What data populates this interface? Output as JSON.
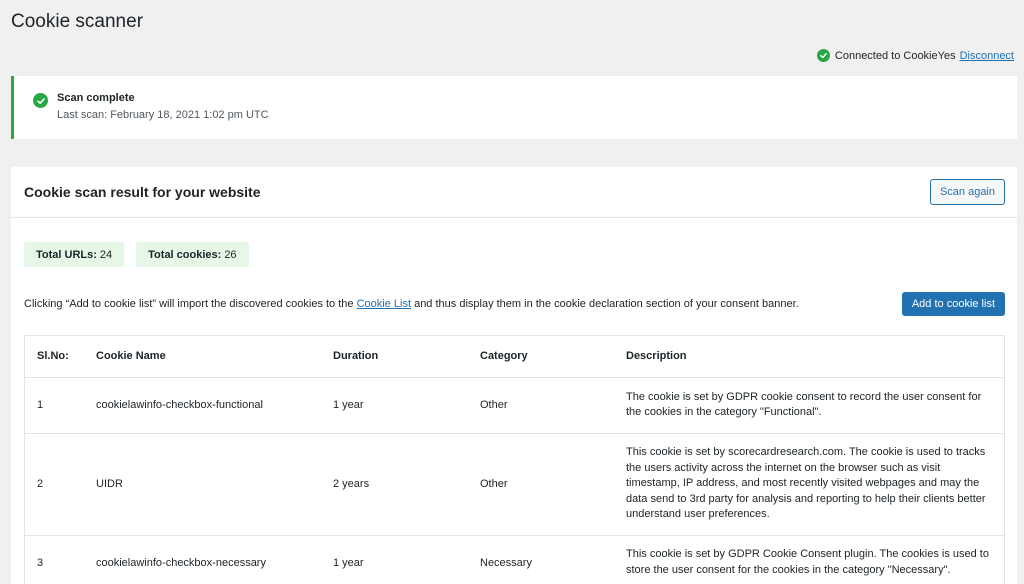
{
  "page_title": "Cookie scanner",
  "connection": {
    "status_text": "Connected to CookieYes",
    "disconnect_label": "Disconnect"
  },
  "notice": {
    "title": "Scan complete",
    "subtitle": "Last scan: February 18, 2021 1:02 pm UTC"
  },
  "panel": {
    "title": "Cookie scan result for your website",
    "scan_again_label": "Scan again"
  },
  "stats": {
    "urls_label": "Total URLs:",
    "urls_value": "24",
    "cookies_label": "Total cookies:",
    "cookies_value": "26"
  },
  "info": {
    "text_before": "Clicking “Add to cookie list” will import the discovered cookies to the ",
    "link_label": "Cookie List",
    "text_after": " and thus display them in the cookie declaration section of your consent banner.",
    "add_button_label": "Add to cookie list"
  },
  "table": {
    "headers": [
      "Sl.No:",
      "Cookie Name",
      "Duration",
      "Category",
      "Description"
    ],
    "rows": [
      {
        "no": "1",
        "name": "cookielawinfo-checkbox-functional",
        "duration": "1 year",
        "category": "Other",
        "description": "The cookie is set by GDPR cookie consent to record the user consent for the cookies in the category \"Functional\"."
      },
      {
        "no": "2",
        "name": "UIDR",
        "duration": "2 years",
        "category": "Other",
        "description": "This cookie is set by scorecardresearch.com. The cookie is used to tracks the users activity across the internet on the browser such as visit timestamp, IP address, and most recently visited webpages and may the data send to 3rd party for analysis and reporting to help their clients better understand user preferences."
      },
      {
        "no": "3",
        "name": "cookielawinfo-checkbox-necessary",
        "duration": "1 year",
        "category": "Necessary",
        "description": "This cookie is set by GDPR Cookie Consent plugin. The cookies is used to store the user consent for the cookies in the category \"Necessary\"."
      }
    ]
  },
  "colors": {
    "success": "#27a844",
    "primary": "#2271b1",
    "stat_bg": "#e7f7e7",
    "page_bg": "#f0f0f1"
  },
  "icons": {
    "connected": "check-circle-icon",
    "scan_complete": "check-circle-icon"
  }
}
